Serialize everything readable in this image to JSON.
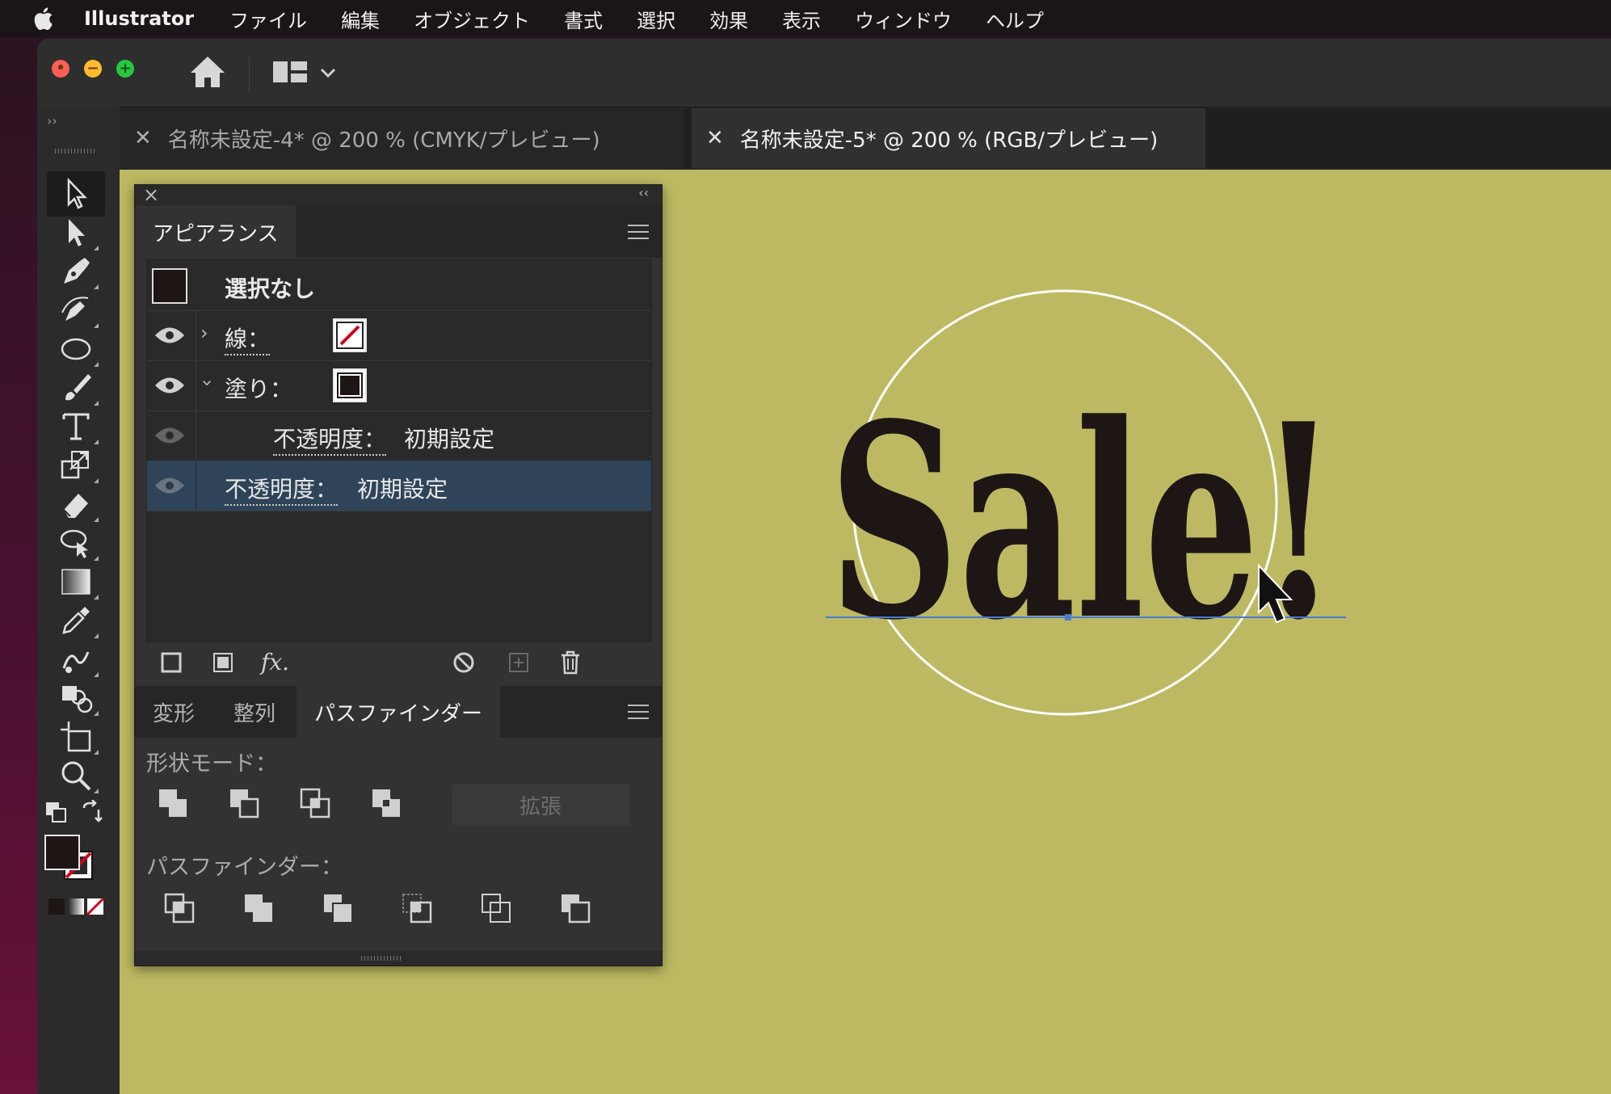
{
  "menubar": {
    "app_name": "Illustrator",
    "items": [
      "ファイル",
      "編集",
      "オブジェクト",
      "書式",
      "選択",
      "効果",
      "表示",
      "ウィンドウ",
      "ヘルプ"
    ]
  },
  "doc_tabs": [
    {
      "label": "名称未設定-4* @ 200 % (CMYK/プレビュー)",
      "close": "✕",
      "active": false
    },
    {
      "label": "名称未設定-5* @ 200 % (RGB/プレビュー)",
      "close": "✕",
      "active": true
    }
  ],
  "toolbar": {
    "collapse_glyph": "››",
    "tools": [
      "selection-tool",
      "direct-selection-tool",
      "pen-tool",
      "curvature-tool",
      "ellipse-tool",
      "paintbrush-tool",
      "type-tool",
      "scale-tool",
      "eraser-tool",
      "lasso-tool",
      "gradient-tool",
      "eyedropper-tool",
      "blend-tool",
      "shape-builder-tool",
      "artboard-tool",
      "zoom-tool"
    ],
    "active_tool": "selection-tool"
  },
  "appearance_panel": {
    "tab_label": "アピアランス",
    "rows": {
      "header": "選択なし",
      "stroke_label": "線：",
      "fill_label": "塗り：",
      "fill_opacity_label": "不透明度：",
      "fill_opacity_value": "初期設定",
      "opacity_label": "不透明度：",
      "opacity_value": "初期設定"
    },
    "fx_label": "fx."
  },
  "pathfinder_panel": {
    "tabs": [
      "変形",
      "整列",
      "パスファインダー"
    ],
    "active_tab": "パスファインダー",
    "shape_modes_label": "形状モード：",
    "pathfinders_label": "パスファインダー：",
    "expand_label": "拡張"
  },
  "artwork": {
    "text": "Sale!",
    "text_color": "#1d1614",
    "canvas_color": "#bdb963",
    "circle_color": "#ffffff",
    "baseline_color": "#4a7bd4"
  },
  "colors": {
    "accent_selected_row": "#2f4459",
    "none_swatch_red": "#d0021b"
  }
}
